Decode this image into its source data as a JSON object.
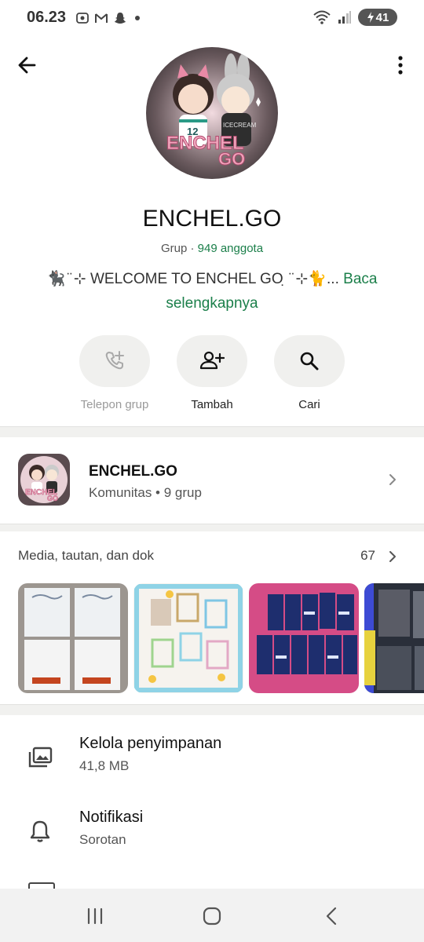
{
  "status_bar": {
    "time": "06.23",
    "battery": "41"
  },
  "group": {
    "name": "ENCHEL.GO",
    "type": "Grup",
    "separator": "·",
    "members": "949 anggota",
    "description": "🐈‍⬛ ̈ ⊹ WELCOME TO ENCHEL GO ̣ ̈ ⊹🐈...",
    "read_more": "Baca selengkapnya",
    "avatar_text": "ENCHEL GO"
  },
  "actions": [
    {
      "label": "Telepon grup",
      "icon": "call-add-icon",
      "enabled": false
    },
    {
      "label": "Tambah",
      "icon": "add-person-icon",
      "enabled": true
    },
    {
      "label": "Cari",
      "icon": "search-icon",
      "enabled": true
    }
  ],
  "community": {
    "name": "ENCHEL.GO",
    "subtitle": "Komunitas • 9 grup"
  },
  "media": {
    "title": "Media, tautan, dan dok",
    "count": "67"
  },
  "settings": [
    {
      "title": "Kelola penyimpanan",
      "subtitle": "41,8 MB",
      "icon": "storage-icon"
    },
    {
      "title": "Notifikasi",
      "subtitle": "Sorotan",
      "icon": "bell-icon"
    }
  ],
  "colors": {
    "accent_green": "#1b7f4a",
    "pill_bg": "#f0f0ee"
  }
}
